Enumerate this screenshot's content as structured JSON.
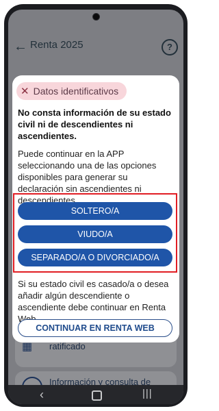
{
  "app": {
    "title": "Renta 2025",
    "back_icon": "arrow-left-icon",
    "help_icon": "help-circle-icon",
    "help_glyph": "?"
  },
  "background_cards": [
    {
      "label": "ratificado",
      "icon": "building-icon"
    },
    {
      "label": "Información y consulta de",
      "icon": "info-circle-icon"
    }
  ],
  "dialog": {
    "chip": {
      "icon": "close-icon",
      "label": "Datos identificativos"
    },
    "heading": "No consta información de su estado civil ni de descendientes ni ascendientes.",
    "body": "Puede continuar en la APP seleccionando una de las opciones disponibles para generar su declaración sin ascendientes ni descendientes.",
    "options": [
      {
        "label": "SOLTERO/A"
      },
      {
        "label": "VIUDO/A"
      },
      {
        "label": "SEPARADO/A O DIVORCIADO/A"
      }
    ],
    "note": "Si su estado civil es casado/a o desea añadir algún descendiente o ascendiente debe continuar en Renta Web.",
    "renta_web_button": "CONTINUAR EN RENTA WEB"
  },
  "navbar": {
    "back_icon": "nav-back-icon",
    "home_icon": "nav-home-icon",
    "recent_icon": "nav-recent-apps-icon"
  },
  "colors": {
    "primary_button": "#1f55a8",
    "chip_bg": "#f8d6db",
    "highlight": "#e11d23"
  }
}
